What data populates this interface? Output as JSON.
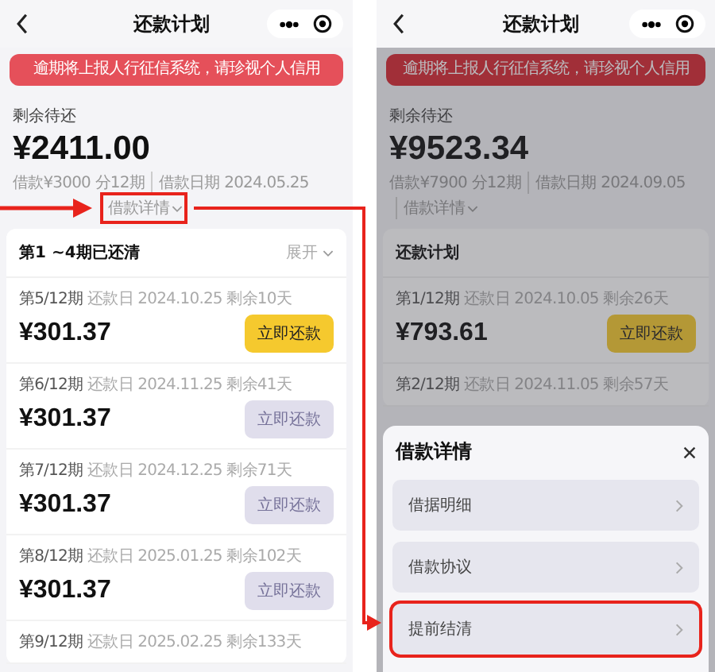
{
  "left_screen": {
    "nav": {
      "title": "还款计划"
    },
    "banner": "逾期将上报人行征信系统，请珍视个人信用",
    "summary": {
      "label": "剩余待还",
      "amount": "¥2411.00",
      "loan": "借款¥3000 分12期",
      "date": "借款日期 2024.05.25",
      "details_link": {
        "label": "借款详情",
        "annotated": true
      }
    },
    "paid_header": {
      "label": "第1 ~4期已还清",
      "toggle": "展开"
    },
    "installments": [
      {
        "period": "第5/12期",
        "due_label": "还款日",
        "date": "2024.10.25",
        "remaining": "剩余10天",
        "amount": "¥301.37",
        "button": "立即还款",
        "enabled": true
      },
      {
        "period": "第6/12期",
        "due_label": "还款日",
        "date": "2024.11.25",
        "remaining": "剩余41天",
        "amount": "¥301.37",
        "button": "立即还款",
        "enabled": false
      },
      {
        "period": "第7/12期",
        "due_label": "还款日",
        "date": "2024.12.25",
        "remaining": "剩余71天",
        "amount": "¥301.37",
        "button": "立即还款",
        "enabled": false
      },
      {
        "period": "第8/12期",
        "due_label": "还款日",
        "date": "2025.01.25",
        "remaining": "剩余102天",
        "amount": "¥301.37",
        "button": "立即还款",
        "enabled": false
      },
      {
        "period": "第9/12期",
        "due_label": "还款日",
        "date": "2025.02.25",
        "remaining": "剩余133天"
      }
    ]
  },
  "right_screen": {
    "nav": {
      "title": "还款计划"
    },
    "banner": "逾期将上报人行征信系统，请珍视个人信用",
    "summary": {
      "label": "剩余待还",
      "amount": "¥9523.34",
      "loan": "借款¥7900 分12期",
      "date": "借款日期 2024.09.05",
      "details_link": {
        "label": "借款详情"
      }
    },
    "plan_header": {
      "label": "还款计划"
    },
    "installments": [
      {
        "period": "第1/12期",
        "due_label": "还款日",
        "date": "2024.10.05",
        "remaining": "剩余26天",
        "amount": "¥793.61",
        "button": "立即还款",
        "enabled": true
      },
      {
        "period": "第2/12期",
        "due_label": "还款日",
        "date": "2024.11.05",
        "remaining": "剩余57天"
      }
    ],
    "sheet": {
      "title": "借款详情",
      "items": [
        {
          "label": "借据明细",
          "annotated": false
        },
        {
          "label": "借款协议",
          "annotated": false
        },
        {
          "label": "提前结清",
          "annotated": true
        }
      ]
    }
  }
}
